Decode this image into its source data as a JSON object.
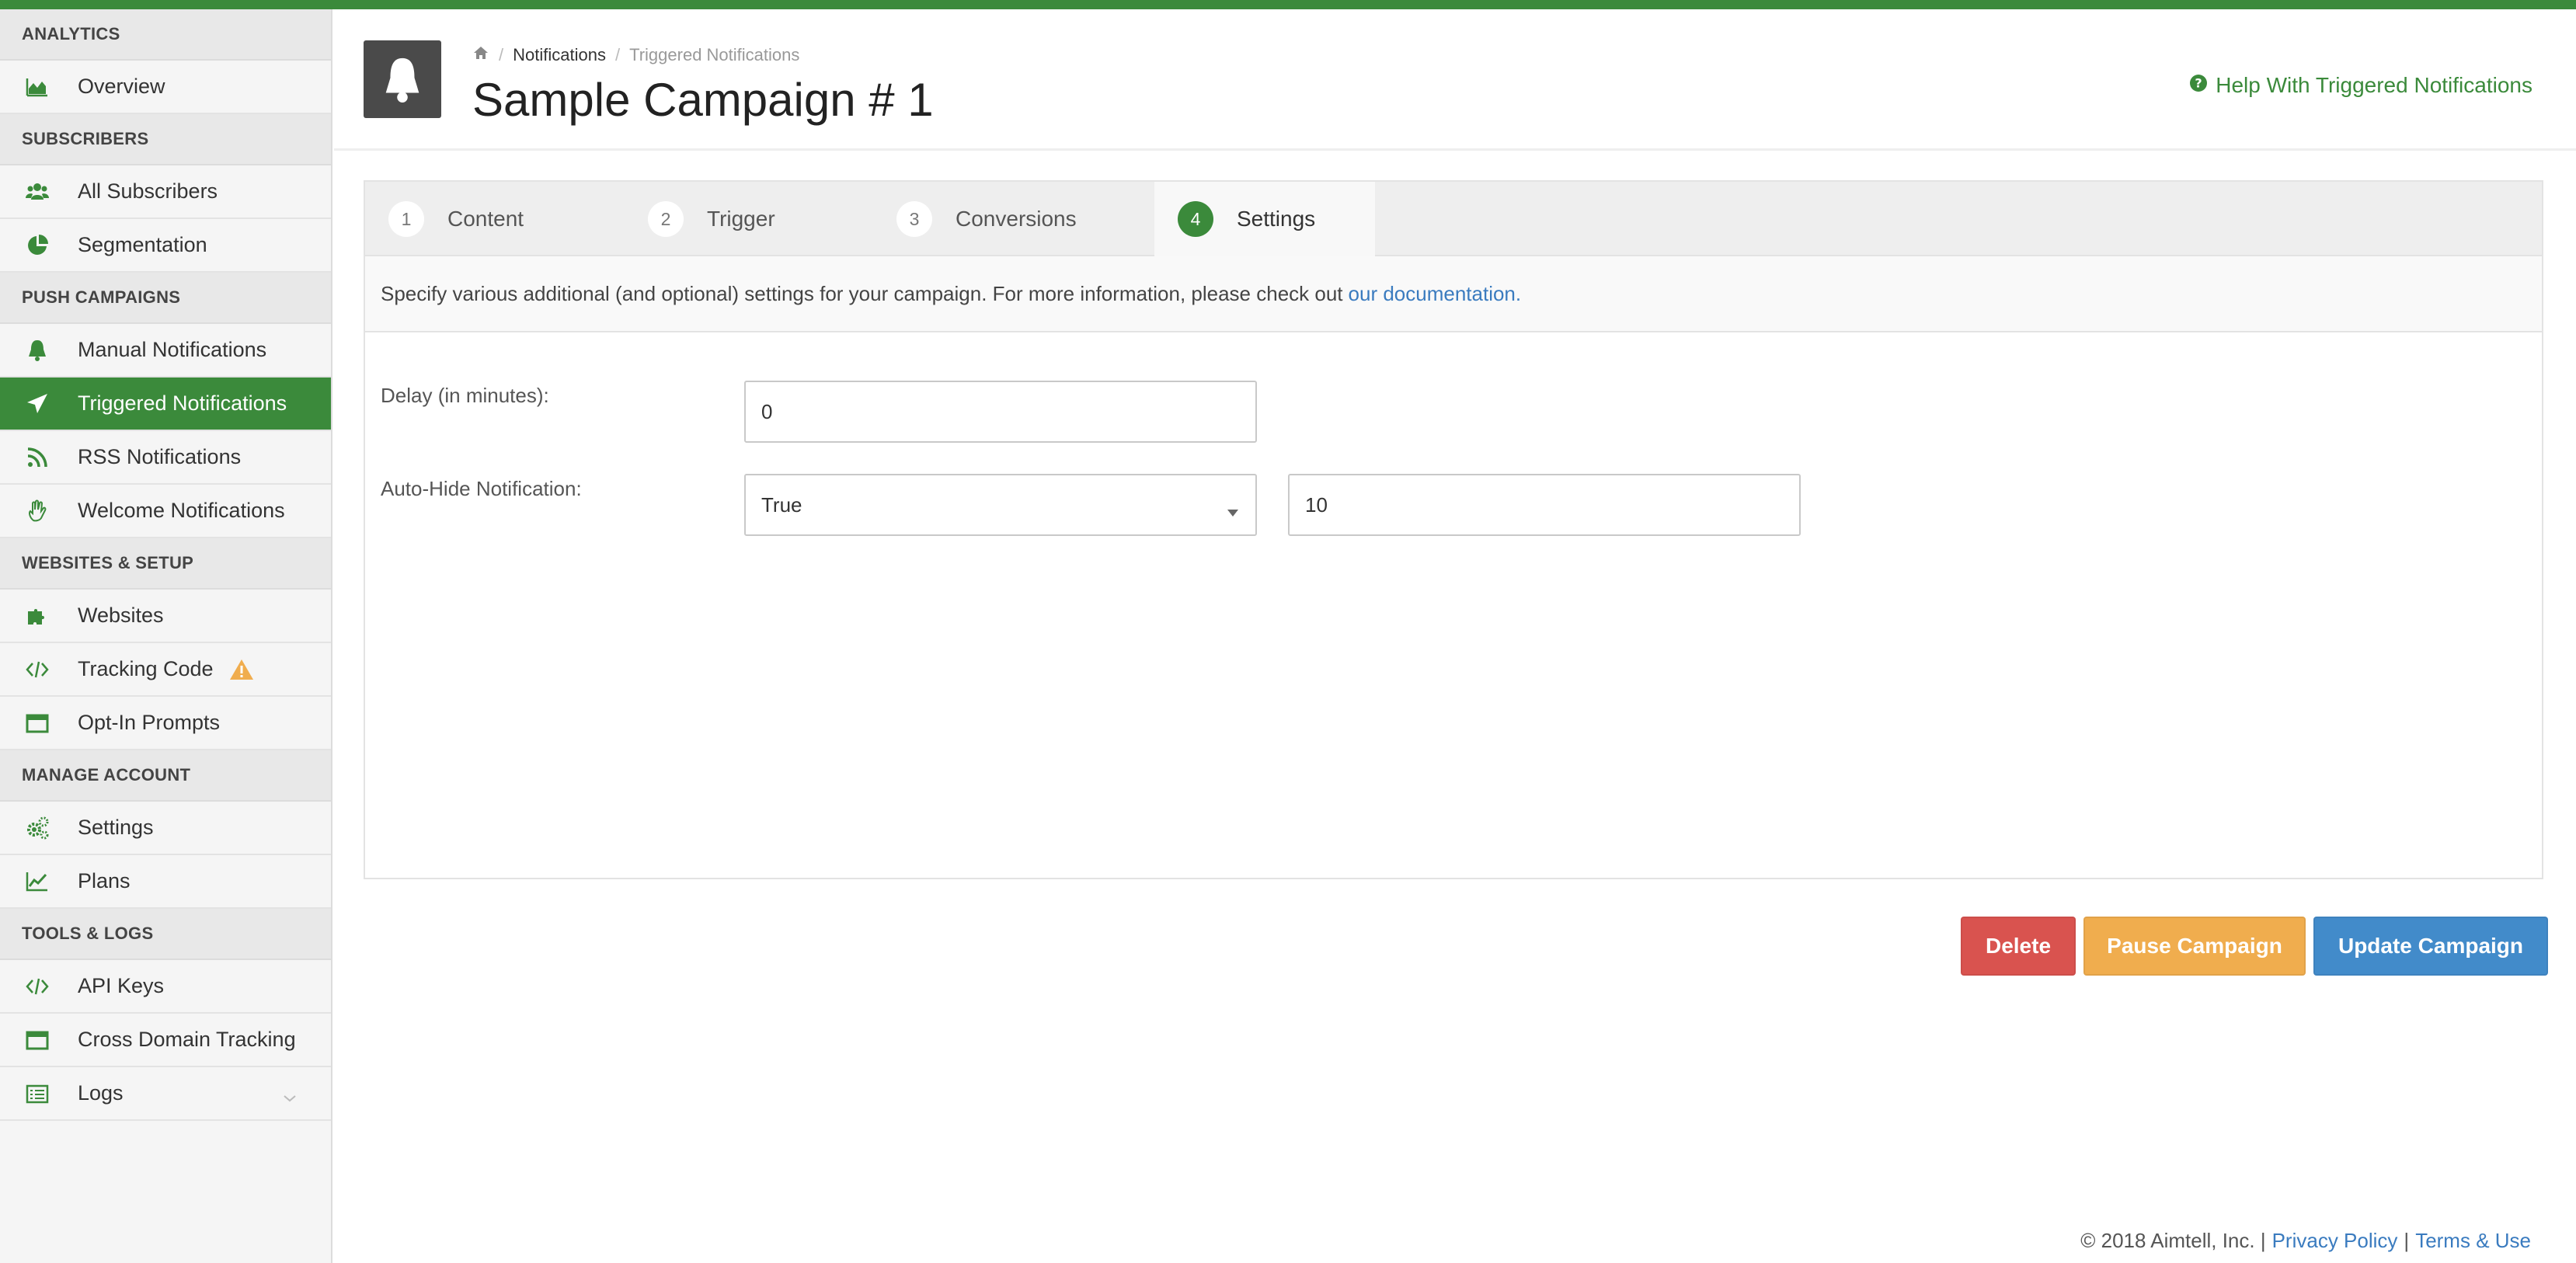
{
  "colors": {
    "brand": "#3b8a3b",
    "delete": "#d9534f",
    "pause": "#f0ad4e",
    "update": "#428bca",
    "link": "#3a7bbf"
  },
  "sidebar": {
    "sections": [
      {
        "label": "ANALYTICS",
        "items": [
          {
            "label": "Overview",
            "icon": "area-chart-icon"
          }
        ]
      },
      {
        "label": "SUBSCRIBERS",
        "items": [
          {
            "label": "All Subscribers",
            "icon": "users-icon"
          },
          {
            "label": "Segmentation",
            "icon": "pie-chart-icon"
          }
        ]
      },
      {
        "label": "PUSH CAMPAIGNS",
        "items": [
          {
            "label": "Manual Notifications",
            "icon": "bell-icon"
          },
          {
            "label": "Triggered Notifications",
            "icon": "paper-plane-icon",
            "active": true
          },
          {
            "label": "RSS Notifications",
            "icon": "rss-icon"
          },
          {
            "label": "Welcome Notifications",
            "icon": "hand-wave-icon"
          }
        ]
      },
      {
        "label": "WEBSITES & SETUP",
        "items": [
          {
            "label": "Websites",
            "icon": "puzzle-icon"
          },
          {
            "label": "Tracking Code",
            "icon": "code-icon",
            "warning": true
          },
          {
            "label": "Opt-In Prompts",
            "icon": "window-icon"
          }
        ]
      },
      {
        "label": "MANAGE ACCOUNT",
        "items": [
          {
            "label": "Settings",
            "icon": "gears-icon"
          },
          {
            "label": "Plans",
            "icon": "line-chart-icon"
          }
        ]
      },
      {
        "label": "TOOLS & LOGS",
        "items": [
          {
            "label": "API Keys",
            "icon": "code-icon"
          },
          {
            "label": "Cross Domain Tracking",
            "icon": "window-icon"
          },
          {
            "label": "Logs",
            "icon": "list-icon",
            "expandable": true
          }
        ]
      }
    ]
  },
  "header": {
    "breadcrumb": {
      "home_icon": "home-icon",
      "link": "Notifications",
      "current": "Triggered Notifications"
    },
    "title": "Sample Campaign # 1",
    "help_label": "Help With Triggered Notifications"
  },
  "tabs": [
    {
      "num": "1",
      "label": "Content"
    },
    {
      "num": "2",
      "label": "Trigger"
    },
    {
      "num": "3",
      "label": "Conversions"
    },
    {
      "num": "4",
      "label": "Settings",
      "active": true
    }
  ],
  "info": {
    "text": "Specify various additional (and optional) settings for your campaign. For more information, please check out",
    "link": "our documentation."
  },
  "form": {
    "delay_label": "Delay (in minutes):",
    "delay_value": "0",
    "autohide_label": "Auto-Hide Notification:",
    "autohide_selected": "True",
    "autohide_seconds": "10"
  },
  "buttons": {
    "delete": "Delete",
    "pause": "Pause Campaign",
    "update": "Update Campaign"
  },
  "footer": {
    "copyright": "© 2018 Aimtell, Inc. |",
    "privacy": "Privacy Policy",
    "sep": "|",
    "terms": "Terms & Use"
  }
}
